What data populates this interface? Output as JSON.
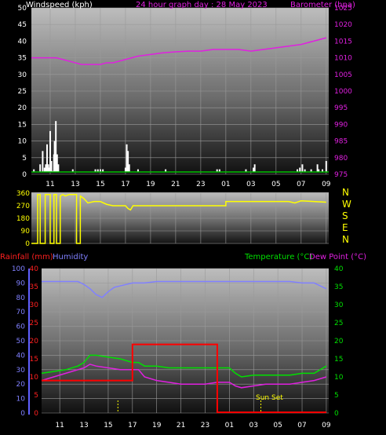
{
  "title": "24 hour graph day : 28 May 2023",
  "colors": {
    "wind": "#ffffff",
    "wind_gust_base": "#00c000",
    "barometer": "#e020e0",
    "direction": "#ffff00",
    "rainfall": "#ff0000",
    "humidity": "#8080ff",
    "temperature": "#00e000",
    "dewpoint": "#e020e0",
    "sun_marker": "#ffff00"
  },
  "x_ticks": [
    "11",
    "13",
    "15",
    "17",
    "19",
    "21",
    "23",
    "01",
    "03",
    "05",
    "07",
    "09"
  ],
  "chart_data": [
    {
      "type": "bar",
      "title": "24 hour graph day : 28 May 2023",
      "ylabel_left": "Windspeed (kph)",
      "ylabel_right": "Barometer (hpa)",
      "yticks_left": [
        "0",
        "5",
        "10",
        "15",
        "20",
        "25",
        "30",
        "35",
        "40",
        "45",
        "50"
      ],
      "yticks_right": [
        "975",
        "980",
        "985",
        "990",
        "995",
        "1000",
        "1005",
        "1010",
        "1015",
        "1020",
        "1025"
      ],
      "ylim_left": [
        0,
        50
      ],
      "ylim_right": [
        975,
        1025
      ],
      "x_range": [
        9.5,
        33.2
      ],
      "wind_bars": [
        {
          "x": 9.7,
          "v": 1.5
        },
        {
          "x": 10.2,
          "v": 3
        },
        {
          "x": 10.4,
          "v": 7
        },
        {
          "x": 10.55,
          "v": 2
        },
        {
          "x": 10.65,
          "v": 3
        },
        {
          "x": 10.75,
          "v": 9
        },
        {
          "x": 10.85,
          "v": 3
        },
        {
          "x": 10.95,
          "v": 2
        },
        {
          "x": 11.0,
          "v": 13
        },
        {
          "x": 11.1,
          "v": 4
        },
        {
          "x": 11.2,
          "v": 1
        },
        {
          "x": 11.3,
          "v": 6
        },
        {
          "x": 11.35,
          "v": 10
        },
        {
          "x": 11.45,
          "v": 16
        },
        {
          "x": 11.55,
          "v": 6
        },
        {
          "x": 11.65,
          "v": 3
        },
        {
          "x": 12.8,
          "v": 1.5
        },
        {
          "x": 14.6,
          "v": 1.5
        },
        {
          "x": 14.8,
          "v": 1.5
        },
        {
          "x": 15.0,
          "v": 1.5
        },
        {
          "x": 15.2,
          "v": 1.5
        },
        {
          "x": 17.0,
          "v": 2
        },
        {
          "x": 17.1,
          "v": 9
        },
        {
          "x": 17.2,
          "v": 7
        },
        {
          "x": 17.3,
          "v": 3
        },
        {
          "x": 18.0,
          "v": 1.5
        },
        {
          "x": 20.2,
          "v": 1.5
        },
        {
          "x": 24.3,
          "v": 1.5
        },
        {
          "x": 24.5,
          "v": 1.5
        },
        {
          "x": 26.6,
          "v": 1.5
        },
        {
          "x": 27.2,
          "v": 2
        },
        {
          "x": 27.3,
          "v": 3
        },
        {
          "x": 30.7,
          "v": 1.5
        },
        {
          "x": 30.9,
          "v": 2
        },
        {
          "x": 31.1,
          "v": 3
        },
        {
          "x": 31.3,
          "v": 1.5
        },
        {
          "x": 31.8,
          "v": 1.5
        },
        {
          "x": 32.3,
          "v": 3
        },
        {
          "x": 32.4,
          "v": 1.5
        },
        {
          "x": 32.7,
          "v": 1.5
        },
        {
          "x": 33.0,
          "v": 4
        }
      ],
      "barometer": {
        "x": [
          9.5,
          10.5,
          11.5,
          12.0,
          13.0,
          13.5,
          14.0,
          14.5,
          15.0,
          15.5,
          16.0,
          17.0,
          18.0,
          19.0,
          20.0,
          21.0,
          22.0,
          23.0,
          24.0,
          25.0,
          26.0,
          27.0,
          28.0,
          29.0,
          30.0,
          31.0,
          32.0,
          33.0
        ],
        "y": [
          1010,
          1010,
          1010,
          1009.5,
          1008.5,
          1008,
          1008,
          1008,
          1008,
          1008.5,
          1008.5,
          1009.5,
          1010.5,
          1011,
          1011.5,
          1011.8,
          1012,
          1012,
          1012.5,
          1012.5,
          1012.5,
          1012,
          1012.5,
          1013,
          1013.5,
          1014,
          1015,
          1016
        ]
      }
    },
    {
      "type": "line",
      "title": "",
      "yticks": [
        "0",
        "90",
        "180",
        "270",
        "360"
      ],
      "ylim": [
        0,
        360
      ],
      "compass_labels": [
        "N",
        "W",
        "S",
        "E",
        "N"
      ],
      "direction": {
        "x": [
          9.5,
          10.0,
          10.0,
          10.2,
          10.2,
          10.6,
          10.6,
          11.0,
          11.0,
          11.3,
          11.3,
          11.5,
          11.5,
          11.8,
          11.8,
          12.0,
          12.2,
          12.5,
          12.6,
          13.1,
          13.1,
          13.4,
          13.4,
          13.7,
          14.0,
          14.5,
          15.0,
          15.5,
          16.0,
          17.0,
          17.2,
          17.4,
          17.6,
          18.0,
          19.0,
          20.0,
          21.0,
          22.0,
          23.0,
          24.0,
          25.0,
          25.0,
          26.0,
          27.0,
          28.0,
          29.0,
          30.0,
          30.5,
          31.0,
          32.0,
          33.0
        ],
        "y": [
          0,
          0,
          350,
          350,
          0,
          0,
          350,
          350,
          0,
          0,
          350,
          350,
          0,
          0,
          340,
          350,
          340,
          350,
          350,
          350,
          0,
          0,
          340,
          320,
          290,
          300,
          300,
          280,
          270,
          270,
          250,
          240,
          270,
          270,
          270,
          270,
          270,
          270,
          270,
          270,
          270,
          300,
          300,
          300,
          300,
          300,
          300,
          290,
          305,
          300,
          295
        ]
      }
    },
    {
      "type": "line",
      "title": "",
      "ylabel_left_red": "Rainfall (mm)",
      "ylabel_left_blue": "Humidity",
      "ylabel_right_green": "Temperature (°C)",
      "ylabel_right_pink": "Dew Point (°C)",
      "yticks_humidity": [
        "0",
        "10",
        "20",
        "30",
        "40",
        "50",
        "60",
        "70",
        "80",
        "90",
        "100"
      ],
      "yticks_rain": [
        "0",
        "5",
        "10",
        "15",
        "20",
        "25",
        "30",
        "35",
        "40"
      ],
      "yticks_temp": [
        "0",
        "5",
        "10",
        "15",
        "20",
        "25",
        "30",
        "35",
        "40"
      ],
      "ylim_humidity": [
        0,
        100
      ],
      "ylim_rain": [
        0,
        40
      ],
      "ylim_temp": [
        0,
        40
      ],
      "annotation": "Sun Set",
      "sun_markers_x": [
        15.8,
        27.6
      ],
      "rainfall": {
        "x": [
          9.5,
          17.0,
          17.0,
          24.0,
          24.0,
          33.0
        ],
        "y": [
          9.0,
          9.0,
          19.0,
          19.0,
          0.2,
          0.2
        ]
      },
      "humidity": {
        "x": [
          9.5,
          10.5,
          11.5,
          12.5,
          13.0,
          13.5,
          14.0,
          14.5,
          15.0,
          15.5,
          16.0,
          17.0,
          18.0,
          19.0,
          20.0,
          21.0,
          22.0,
          23.0,
          24.0,
          25.0,
          26.0,
          27.0,
          28.0,
          29.0,
          30.0,
          31.0,
          32.0,
          33.0
        ],
        "y": [
          91,
          91,
          91,
          91,
          89,
          86,
          82,
          80,
          84,
          87,
          88,
          90,
          90,
          91,
          91,
          91,
          91,
          91,
          91,
          91,
          91,
          91,
          91,
          91,
          91,
          90,
          90,
          86
        ]
      },
      "temperature": {
        "x": [
          9.5,
          10.5,
          11.5,
          12.5,
          13.0,
          13.5,
          14.0,
          15.0,
          16.0,
          17.0,
          17.5,
          18.0,
          19.0,
          20.0,
          21.0,
          22.0,
          23.0,
          24.0,
          25.0,
          25.5,
          26.0,
          27.0,
          28.0,
          29.0,
          30.0,
          31.0,
          32.0,
          33.0
        ],
        "y": [
          11,
          11.5,
          12,
          13,
          14,
          16,
          16,
          15.5,
          15,
          14,
          14,
          13,
          13,
          12.5,
          12.5,
          12.5,
          12.5,
          12.5,
          12.5,
          11,
          10,
          10.5,
          10.5,
          10.5,
          10.5,
          11,
          11,
          13
        ]
      },
      "dewpoint": {
        "x": [
          9.5,
          10.5,
          11.5,
          12.5,
          13.0,
          13.5,
          14.0,
          15.0,
          16.0,
          17.0,
          17.5,
          18.0,
          19.0,
          20.0,
          21.0,
          22.0,
          23.0,
          24.0,
          25.0,
          25.5,
          26.0,
          27.0,
          28.0,
          29.0,
          30.0,
          31.0,
          32.0,
          33.0
        ],
        "y": [
          9,
          10,
          11,
          12,
          12.5,
          13.5,
          13,
          12.5,
          12,
          12,
          12,
          10,
          9,
          8.5,
          8,
          8,
          8,
          8.5,
          8.5,
          7.5,
          7,
          7.5,
          8,
          8,
          8,
          8.5,
          9,
          10
        ]
      }
    }
  ]
}
